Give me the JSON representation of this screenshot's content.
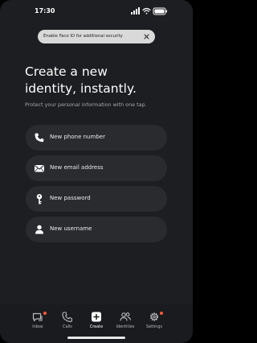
{
  "status_bar": {
    "time": "17:30",
    "icons": [
      "signal-icon",
      "wifi-icon",
      "battery-icon"
    ]
  },
  "banner": {
    "text": "Enable Face ID for additional security",
    "close_icon": "close-icon"
  },
  "hero": {
    "title_line1": "Create a new",
    "title_line2": "identity, instantly.",
    "subtitle": "Protect your personal information with one tap."
  },
  "actions": [
    {
      "label": "New phone number",
      "icon": "phone-icon"
    },
    {
      "label": "New email address",
      "icon": "mail-icon"
    },
    {
      "label": "New password",
      "icon": "key-icon"
    },
    {
      "label": "New username",
      "icon": "person-icon"
    }
  ],
  "tabs": [
    {
      "label": "Inbox",
      "icon": "inbox-icon",
      "badge": true,
      "active": false
    },
    {
      "label": "Calls",
      "icon": "phone-icon",
      "badge": false,
      "active": false
    },
    {
      "label": "Create",
      "icon": "plus-icon",
      "badge": false,
      "active": true
    },
    {
      "label": "Identities",
      "icon": "people-icon",
      "badge": false,
      "active": false
    },
    {
      "label": "Settings",
      "icon": "gear-icon",
      "badge": true,
      "active": false
    }
  ],
  "colors": {
    "background": "#1d1e21",
    "card": "#2a2b2f",
    "banner": "#d9d9d9",
    "badge": "#ff5a3c"
  }
}
